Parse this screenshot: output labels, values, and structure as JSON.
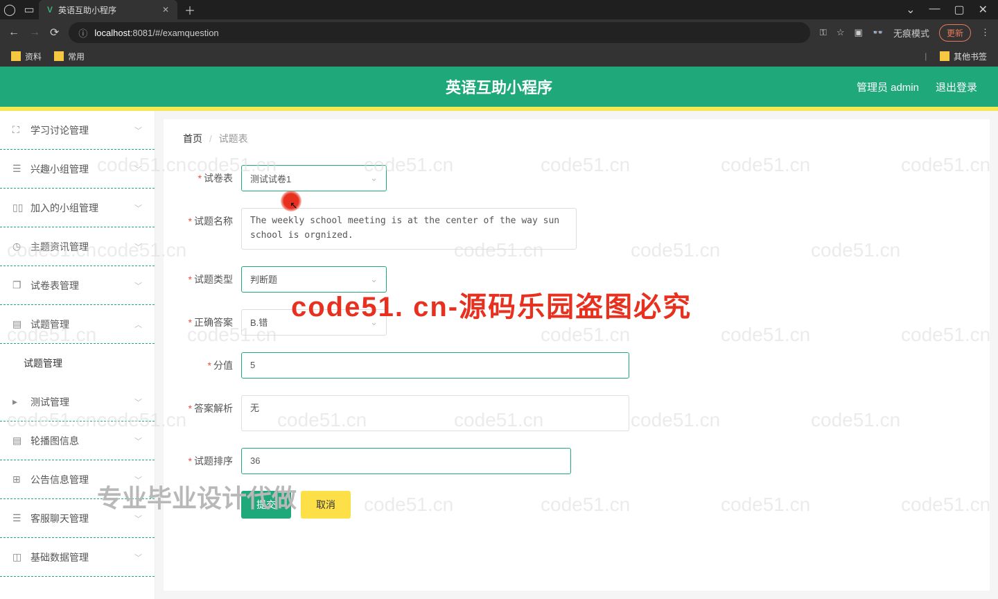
{
  "browser": {
    "tab_title": "英语互助小程序",
    "url_host": "localhost",
    "url_path": ":8081/#/examquestion",
    "incognito": "无痕模式",
    "update": "更新"
  },
  "bookmarks": {
    "b1": "资料",
    "b2": "常用",
    "other": "其他书签"
  },
  "header": {
    "title": "英语互助小程序",
    "user": "管理员 admin",
    "logout": "退出登录"
  },
  "sidebar": {
    "items": [
      {
        "label": "学习讨论管理"
      },
      {
        "label": "兴趣小组管理"
      },
      {
        "label": "加入的小组管理"
      },
      {
        "label": "主题资讯管理"
      },
      {
        "label": "试卷表管理"
      },
      {
        "label": "试题管理"
      },
      {
        "label": "试题管理"
      },
      {
        "label": "测试管理"
      },
      {
        "label": "轮播图信息"
      },
      {
        "label": "公告信息管理"
      },
      {
        "label": "客服聊天管理"
      },
      {
        "label": "基础数据管理"
      }
    ]
  },
  "breadcrumb": {
    "home": "首页",
    "page": "试题表"
  },
  "form": {
    "paper_label": "试卷表",
    "paper_value": "测试试卷1",
    "name_label": "试题名称",
    "name_value": "The weekly school meeting is at the center of the way sun school is orgnized.",
    "type_label": "试题类型",
    "type_value": "判断题",
    "answer_label": "正确答案",
    "answer_value": "B.错",
    "score_label": "分值",
    "score_value": "5",
    "expl_label": "答案解析",
    "expl_value": "无",
    "order_label": "试题排序",
    "order_value": "36",
    "submit": "提交",
    "cancel": "取消"
  },
  "watermarks": {
    "wm": "code51.cn",
    "red": "code51. cn-源码乐园盗图必究",
    "grad": "专业毕业设计代做"
  }
}
